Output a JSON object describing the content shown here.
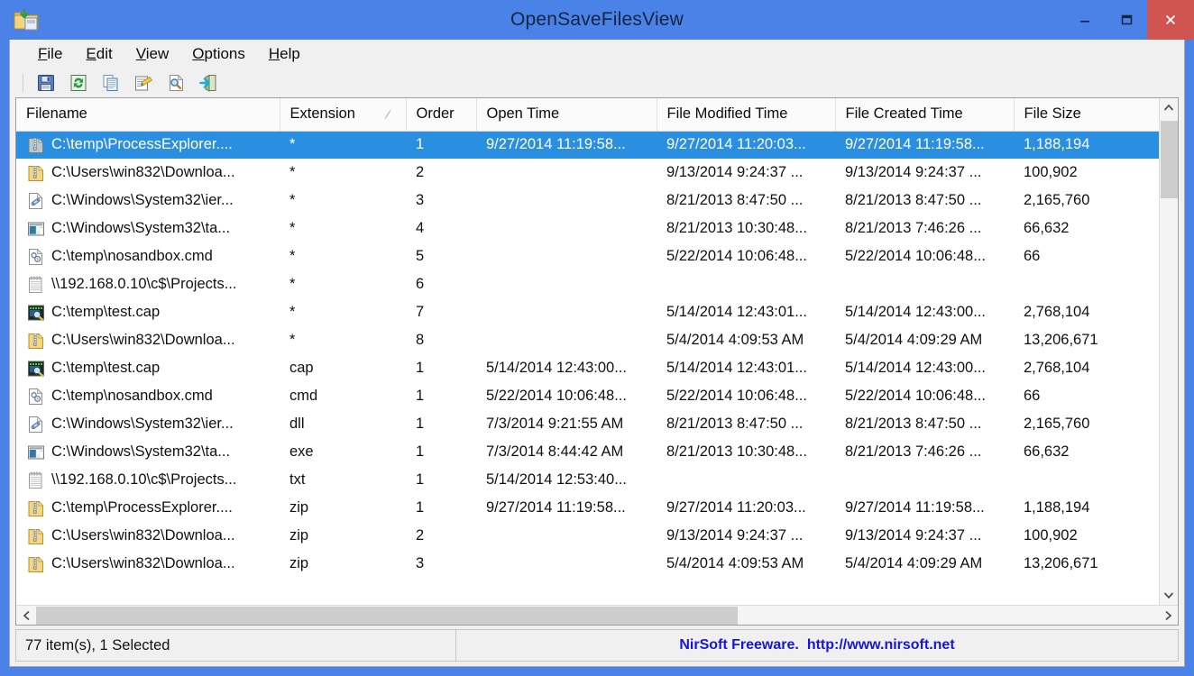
{
  "window": {
    "title": "OpenSaveFilesView",
    "icon": "folder-open-save-icon",
    "controls": {
      "minimize": "minimize-icon",
      "maximize": "maximize-icon",
      "close": "close-icon",
      "minimize_glyph": "–",
      "maximize_glyph": "❐",
      "close_glyph": "✕"
    },
    "accent_color": "#4a82e8",
    "close_button_color": "#d05450"
  },
  "menu": [
    {
      "label": "File",
      "mnemonic": "F",
      "rest": "ile"
    },
    {
      "label": "Edit",
      "mnemonic": "E",
      "rest": "dit"
    },
    {
      "label": "View",
      "mnemonic": "V",
      "rest": "iew"
    },
    {
      "label": "Options",
      "mnemonic": "O",
      "rest": "ptions"
    },
    {
      "label": "Help",
      "mnemonic": "H",
      "rest": "elp"
    }
  ],
  "toolbar": [
    {
      "name": "save-icon",
      "title": "Save Selected Items"
    },
    {
      "name": "refresh-icon",
      "title": "Refresh"
    },
    {
      "name": "copy-icon",
      "title": "Copy Selected Items"
    },
    {
      "name": "properties-icon",
      "title": "Properties"
    },
    {
      "name": "find-icon",
      "title": "Find"
    },
    {
      "name": "exit-icon",
      "title": "Exit"
    }
  ],
  "listview": {
    "columns": [
      {
        "key": "filename",
        "label": "Filename",
        "sorted": false
      },
      {
        "key": "extension",
        "label": "Extension",
        "sorted": true,
        "sort_glyph": "∕"
      },
      {
        "key": "order",
        "label": "Order",
        "sorted": false
      },
      {
        "key": "opentime",
        "label": "Open Time",
        "sorted": false
      },
      {
        "key": "modtime",
        "label": "File Modified Time",
        "sorted": false
      },
      {
        "key": "cretime",
        "label": "File Created Time",
        "sorted": false
      },
      {
        "key": "filesize",
        "label": "File Size",
        "sorted": false
      }
    ],
    "selection_color": "#2a8fe0",
    "rows": [
      {
        "icon": "zip-archive-icon-grey",
        "selected": true,
        "filename": "C:\\temp\\ProcessExplorer....",
        "extension": "*",
        "order": "1",
        "opentime": "9/27/2014 11:19:58...",
        "modtime": "9/27/2014 11:20:03...",
        "cretime": "9/27/2014 11:19:58...",
        "filesize": "1,188,194"
      },
      {
        "icon": "zip-archive-icon",
        "selected": false,
        "filename": "C:\\Users\\win832\\Downloa...",
        "extension": "*",
        "order": "2",
        "opentime": "",
        "modtime": "9/13/2014 9:24:37 ...",
        "cretime": "9/13/2014 9:24:37 ...",
        "filesize": "100,902"
      },
      {
        "icon": "dll-file-icon",
        "selected": false,
        "filename": "C:\\Windows\\System32\\ier...",
        "extension": "*",
        "order": "3",
        "opentime": "",
        "modtime": "8/21/2013 8:47:50 ...",
        "cretime": "8/21/2013 8:47:50 ...",
        "filesize": "2,165,760"
      },
      {
        "icon": "exe-application-icon",
        "selected": false,
        "filename": "C:\\Windows\\System32\\ta...",
        "extension": "*",
        "order": "4",
        "opentime": "",
        "modtime": "8/21/2013 10:30:48...",
        "cretime": "8/21/2013 7:46:26 ...",
        "filesize": "66,632"
      },
      {
        "icon": "cmd-script-icon",
        "selected": false,
        "filename": "C:\\temp\\nosandbox.cmd",
        "extension": "*",
        "order": "5",
        "opentime": "",
        "modtime": "5/22/2014 10:06:48...",
        "cretime": "5/22/2014 10:06:48...",
        "filesize": "66"
      },
      {
        "icon": "text-file-icon",
        "selected": false,
        "filename": "\\\\192.168.0.10\\c$\\Projects...",
        "extension": "*",
        "order": "6",
        "opentime": "",
        "modtime": "",
        "cretime": "",
        "filesize": ""
      },
      {
        "icon": "capture-file-icon",
        "selected": false,
        "filename": "C:\\temp\\test.cap",
        "extension": "*",
        "order": "7",
        "opentime": "",
        "modtime": "5/14/2014 12:43:01...",
        "cretime": "5/14/2014 12:43:00...",
        "filesize": "2,768,104"
      },
      {
        "icon": "zip-archive-icon",
        "selected": false,
        "filename": "C:\\Users\\win832\\Downloa...",
        "extension": "*",
        "order": "8",
        "opentime": "",
        "modtime": "5/4/2014 4:09:53 AM",
        "cretime": "5/4/2014 4:09:29 AM",
        "filesize": "13,206,671"
      },
      {
        "icon": "capture-file-icon",
        "selected": false,
        "filename": "C:\\temp\\test.cap",
        "extension": "cap",
        "order": "1",
        "opentime": "5/14/2014 12:43:00...",
        "modtime": "5/14/2014 12:43:01...",
        "cretime": "5/14/2014 12:43:00...",
        "filesize": "2,768,104"
      },
      {
        "icon": "cmd-script-icon",
        "selected": false,
        "filename": "C:\\temp\\nosandbox.cmd",
        "extension": "cmd",
        "order": "1",
        "opentime": "5/22/2014 10:06:48...",
        "modtime": "5/22/2014 10:06:48...",
        "cretime": "5/22/2014 10:06:48...",
        "filesize": "66"
      },
      {
        "icon": "dll-file-icon",
        "selected": false,
        "filename": "C:\\Windows\\System32\\ier...",
        "extension": "dll",
        "order": "1",
        "opentime": "7/3/2014 9:21:55 AM",
        "modtime": "8/21/2013 8:47:50 ...",
        "cretime": "8/21/2013 8:47:50 ...",
        "filesize": "2,165,760"
      },
      {
        "icon": "exe-application-icon",
        "selected": false,
        "filename": "C:\\Windows\\System32\\ta...",
        "extension": "exe",
        "order": "1",
        "opentime": "7/3/2014 8:44:42 AM",
        "modtime": "8/21/2013 10:30:48...",
        "cretime": "8/21/2013 7:46:26 ...",
        "filesize": "66,632"
      },
      {
        "icon": "text-file-icon",
        "selected": false,
        "filename": "\\\\192.168.0.10\\c$\\Projects...",
        "extension": "txt",
        "order": "1",
        "opentime": "5/14/2014 12:53:40...",
        "modtime": "",
        "cretime": "",
        "filesize": ""
      },
      {
        "icon": "zip-archive-icon",
        "selected": false,
        "filename": "C:\\temp\\ProcessExplorer....",
        "extension": "zip",
        "order": "1",
        "opentime": "9/27/2014 11:19:58...",
        "modtime": "9/27/2014 11:20:03...",
        "cretime": "9/27/2014 11:19:58...",
        "filesize": "1,188,194"
      },
      {
        "icon": "zip-archive-icon",
        "selected": false,
        "filename": "C:\\Users\\win832\\Downloa...",
        "extension": "zip",
        "order": "2",
        "opentime": "",
        "modtime": "9/13/2014 9:24:37 ...",
        "cretime": "9/13/2014 9:24:37 ...",
        "filesize": "100,902"
      },
      {
        "icon": "zip-archive-icon",
        "selected": false,
        "filename": "C:\\Users\\win832\\Downloa...",
        "extension": "zip",
        "order": "3",
        "opentime": "",
        "modtime": "5/4/2014 4:09:53 AM",
        "cretime": "5/4/2014 4:09:29 AM",
        "filesize": "13,206,671"
      }
    ]
  },
  "scrollbars": {
    "vertical": {
      "up_glyph": "⌃",
      "down_glyph": "⌄",
      "thumb_position_pct": 3,
      "thumb_size_pct": 16
    },
    "horizontal": {
      "left_glyph": "‹",
      "right_glyph": "›",
      "thumb_position_pct": 0,
      "thumb_size_pct": 62
    }
  },
  "statusbar": {
    "left": "77 item(s), 1 Selected",
    "brand": "NirSoft Freeware.",
    "url": "http://www.nirsoft.net",
    "link_color": "#1616d8"
  }
}
